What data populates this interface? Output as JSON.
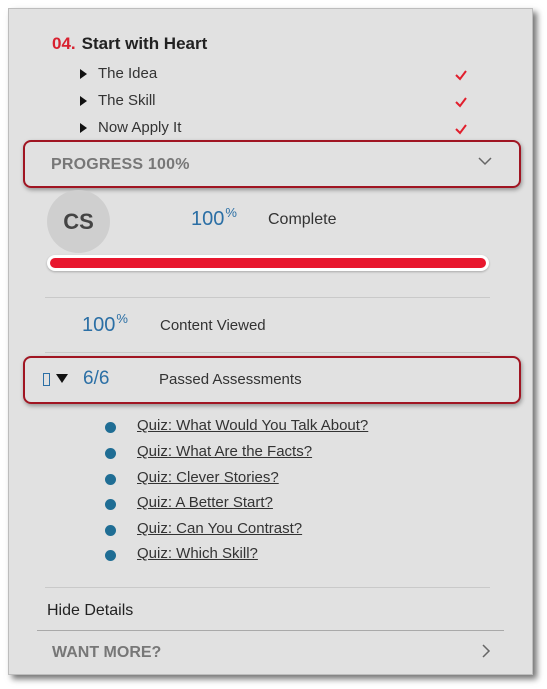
{
  "lesson": {
    "number": "04.",
    "title": "Start with Heart"
  },
  "topics": [
    {
      "label": "The Idea",
      "status": "check-icon"
    },
    {
      "label": "The Skill",
      "status": "check-icon"
    },
    {
      "label": "Now Apply It",
      "status": "check-icon"
    }
  ],
  "progress": {
    "header": "PROGRESS 100%",
    "avatar_initials": "CS",
    "percent_value": "100",
    "percent_symbol": "%",
    "complete_label": "Complete",
    "bar_fraction": 1.0,
    "content_percent_value": "100",
    "content_percent_symbol": "%",
    "content_label": "Content Viewed"
  },
  "assessments": {
    "count": "6/6",
    "label": "Passed Assessments",
    "quizzes": [
      "Quiz: What Would You Talk About?",
      "Quiz: What Are the Facts?",
      "Quiz: Clever Stories?",
      "Quiz: A Better Start?",
      "Quiz: Can You Contrast?",
      "Quiz: Which Skill?"
    ]
  },
  "footer": {
    "hide_details": "Hide Details",
    "want_more": "WANT MORE?"
  },
  "colors": {
    "accent_red": "#d8202f",
    "bar_red": "#e8172e",
    "highlight_border": "#a01522",
    "link_blue": "#2b6fa5",
    "bullet_blue": "#1f6d94",
    "panel_bg": "#e1e1e1"
  }
}
